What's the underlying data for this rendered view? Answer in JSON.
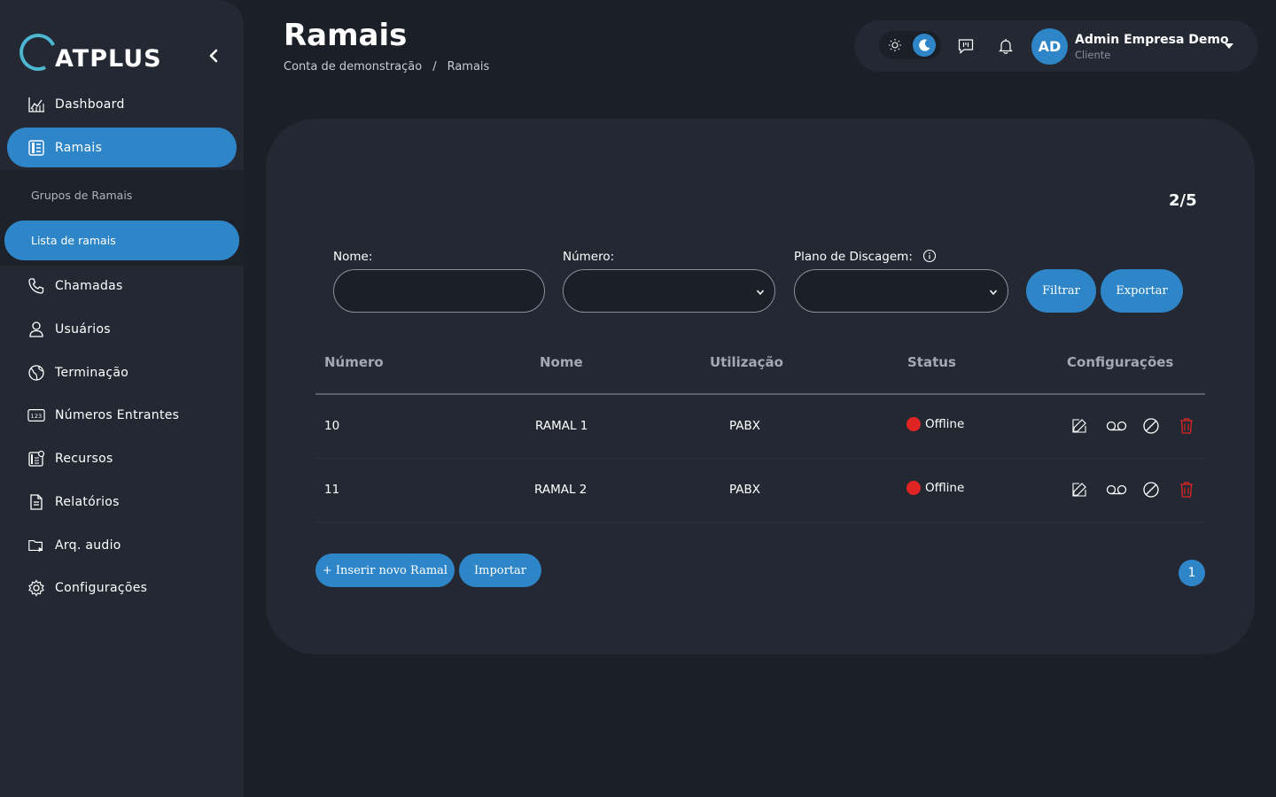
{
  "brand": {
    "logo_text": "ATPLUS"
  },
  "sidebar": {
    "items": [
      {
        "label": "Dashboard",
        "icon": "chart-icon"
      },
      {
        "label": "Ramais",
        "icon": "phone-book-icon",
        "active": true
      },
      {
        "label": "Chamadas",
        "icon": "phone-icon"
      },
      {
        "label": "Usuários",
        "icon": "user-icon"
      },
      {
        "label": "Terminação",
        "icon": "globe-icon"
      },
      {
        "label": "Números Entrantes",
        "icon": "numbers-123-icon"
      },
      {
        "label": "Recursos",
        "icon": "resources-icon"
      },
      {
        "label": "Relatórios",
        "icon": "report-icon"
      },
      {
        "label": "Arq. audio",
        "icon": "audio-folder-icon"
      },
      {
        "label": "Configurações",
        "icon": "gear-icon"
      }
    ],
    "submenu": [
      {
        "label": "Grupos de Ramais"
      },
      {
        "label": "Lista de ramais",
        "active": true
      }
    ]
  },
  "header": {
    "title": "Ramais",
    "breadcrumb": [
      "Conta de demonstração",
      "/",
      "Ramais"
    ]
  },
  "user": {
    "initials": "AD",
    "name": "Admin Empresa Demo",
    "role": "Cliente"
  },
  "filters": {
    "page_count": "2/5",
    "name_label": "Nome:",
    "number_label": "Número:",
    "dialplan_label": "Plano de Discagem:",
    "filter_button": "Filtrar",
    "export_button": "Exportar"
  },
  "table": {
    "columns": [
      "Número",
      "Nome",
      "Utilização",
      "Status",
      "Configurações"
    ],
    "rows": [
      {
        "numero": "10",
        "nome": "RAMAL 1",
        "utilizacao": "PABX",
        "status": "Offline"
      },
      {
        "numero": "11",
        "nome": "RAMAL 2",
        "utilizacao": "PABX",
        "status": "Offline"
      }
    ]
  },
  "footer": {
    "insert_button": "+ Inserir novo Ramal",
    "import_button": "Importar",
    "current_page": "1"
  },
  "colors": {
    "accent": "#2e86c9",
    "background": "#1b1f27",
    "panel": "#232833",
    "offline": "#e02424",
    "delete": "#e02424"
  }
}
